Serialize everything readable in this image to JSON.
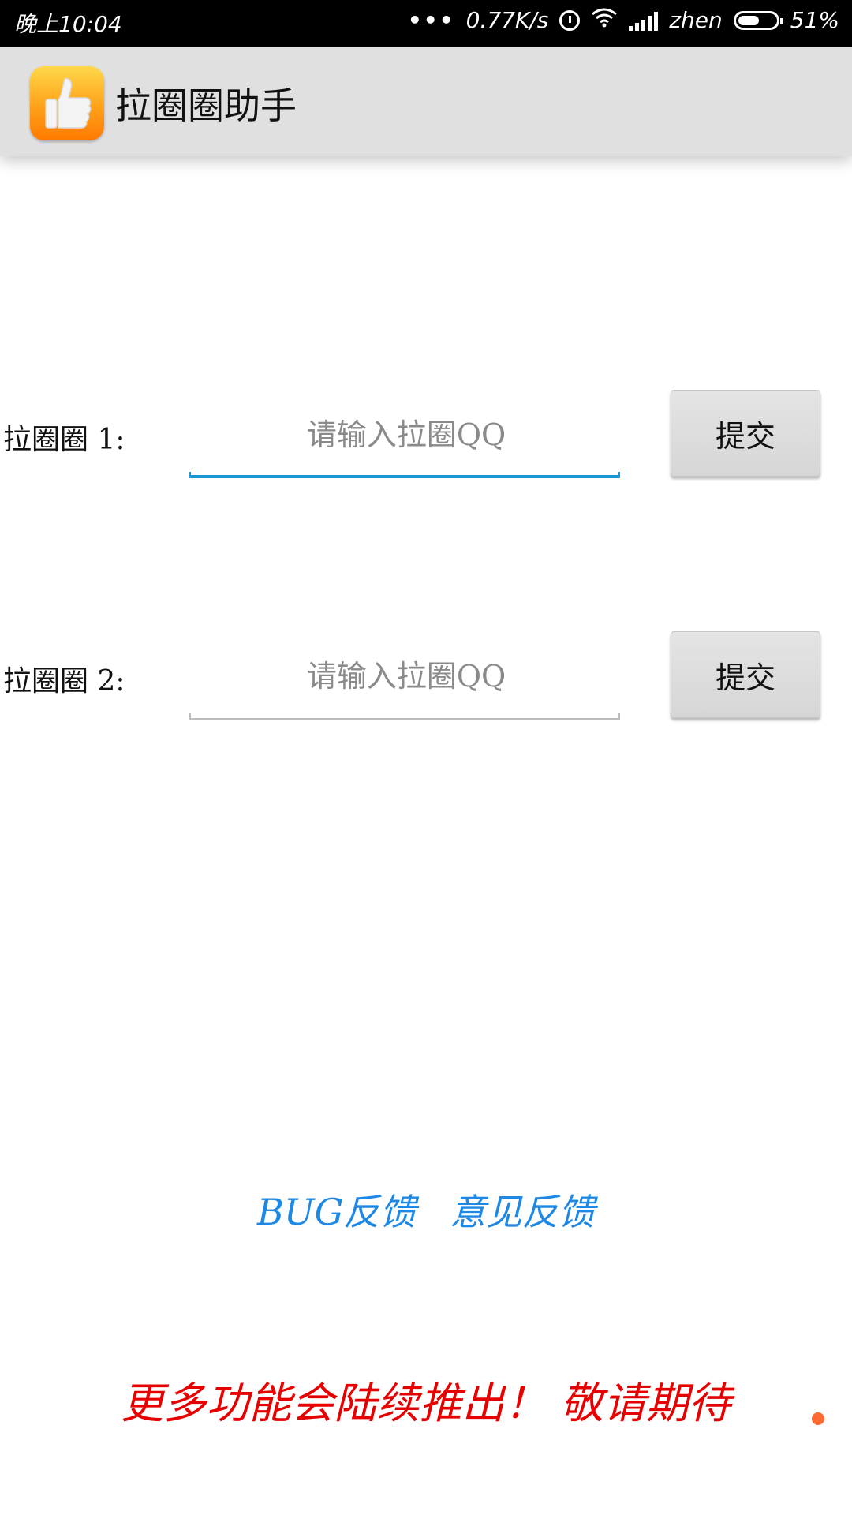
{
  "status_bar": {
    "time": "晚上10:04",
    "dots": "•••",
    "net_speed": "0.77K/s",
    "carrier": "zhen",
    "battery": "51%",
    "icons": [
      "alarm-icon",
      "wifi-icon",
      "signal-icon",
      "battery-icon"
    ]
  },
  "app_bar": {
    "title": "拉圈圈助手",
    "icon": "thumbs-up-icon",
    "icon_colors": [
      "#ffd84a",
      "#ff7a00"
    ]
  },
  "form": {
    "rows": [
      {
        "label": "拉圈圈 1:",
        "placeholder": "请输入拉圈QQ",
        "value": "",
        "submit_label": "提交",
        "focused": true
      },
      {
        "label": "拉圈圈 2:",
        "placeholder": "请输入拉圈QQ",
        "value": "",
        "submit_label": "提交",
        "focused": false
      }
    ]
  },
  "links": {
    "bug_feedback": "BUG反馈",
    "suggestion_feedback": "意见反馈"
  },
  "footer": {
    "notice": "更多功能会陆续推出！ 敬请期待"
  },
  "colors": {
    "accent": "#1a96d4",
    "link": "#1e88e5",
    "notice": "#e60000",
    "dot": "#ff6a33"
  }
}
